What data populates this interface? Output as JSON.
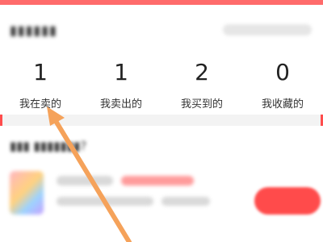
{
  "stats": [
    {
      "value": "1",
      "label": "我在卖的"
    },
    {
      "value": "1",
      "label": "我卖出的"
    },
    {
      "value": "2",
      "label": "我买到的"
    },
    {
      "value": "0",
      "label": "我收藏的"
    }
  ],
  "colors": {
    "accent": "#ff4d4d",
    "arrow": "#f5a25a"
  },
  "icons": [
    "pointer-arrow"
  ]
}
